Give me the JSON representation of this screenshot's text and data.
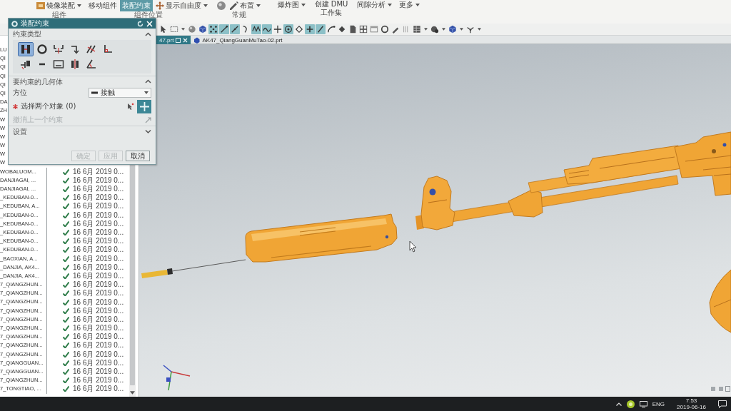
{
  "ribbon": {
    "groups": [
      {
        "label": "组件",
        "items": [
          {
            "label": "镜像装配",
            "selected": false,
            "dropdown": true
          }
        ]
      },
      {
        "label": "组件位置",
        "items": [
          {
            "label": "移动组件",
            "selected": false,
            "dropdown": false
          },
          {
            "label": "装配约束",
            "selected": true,
            "dropdown": false
          },
          {
            "label": "显示自由度",
            "selected": false,
            "dropdown": true
          }
        ]
      },
      {
        "label": "常规",
        "items": [
          {
            "label": "布置",
            "selected": false,
            "dropdown": true
          }
        ]
      },
      {
        "items": [
          {
            "label": "爆炸图",
            "selected": false,
            "dropdown": true
          },
          {
            "label": "创建 DMU 工作集",
            "selected": false,
            "dropdown": false
          },
          {
            "label": "间隙分析",
            "selected": false,
            "dropdown": true
          },
          {
            "label": "更多",
            "selected": false,
            "dropdown": true
          }
        ]
      }
    ]
  },
  "toolbar": [
    {
      "on": false
    },
    {
      "on": false
    },
    {
      "on": false
    },
    {
      "on": false
    },
    {
      "on": true
    },
    {
      "on": true
    },
    {
      "on": true
    },
    {
      "on": false
    },
    {
      "on": true
    },
    {
      "on": true
    },
    {
      "on": false
    },
    {
      "on": true
    },
    {
      "on": false
    },
    {
      "on": true
    },
    {
      "on": true
    },
    {
      "on": false
    },
    {
      "on": false
    },
    {
      "on": false
    },
    {
      "on": false
    },
    {
      "on": false
    },
    {
      "on": false
    },
    {
      "on": false
    },
    {
      "on": false
    },
    {
      "on": false
    },
    {
      "on": false
    },
    {
      "on": false
    },
    {
      "on": false
    }
  ],
  "dialog": {
    "title": "装配约束",
    "constraint_type": {
      "heading": "约束类型",
      "expanded": true,
      "types": [
        {
          "selected": true
        },
        {
          "selected": false
        },
        {
          "selected": false
        },
        {
          "selected": false
        },
        {
          "selected": false
        },
        {
          "selected": false
        },
        {
          "selected": false
        },
        {
          "selected": false
        },
        {
          "selected": false
        },
        {
          "selected": false
        },
        {
          "selected": false
        }
      ]
    },
    "geometry": {
      "heading": "要约束的几何体",
      "expanded": true,
      "orientation_label": "方位",
      "orientation_value": "接触",
      "select_label": "选择两个对象 (0)",
      "required": true,
      "select_active": true,
      "undo_label": "撤消上一个约束",
      "undo_disabled": true
    },
    "settings": {
      "heading": "设置",
      "expanded": false
    },
    "buttons": [
      {
        "label": "确定",
        "disabled": true
      },
      {
        "label": "应用",
        "disabled": true
      },
      {
        "label": "取消",
        "disabled": false
      }
    ]
  },
  "navigator": {
    "covered_rows": [
      {
        "name": "LU"
      },
      {
        "name": "QI"
      },
      {
        "name": "QI"
      },
      {
        "name": "QI"
      },
      {
        "name": "QI"
      },
      {
        "name": "QI"
      },
      {
        "name": "DA"
      },
      {
        "name": "ZH"
      },
      {
        "name": "W"
      },
      {
        "name": "W"
      },
      {
        "name": "W"
      },
      {
        "name": "W"
      },
      {
        "name": "W"
      },
      {
        "name": "W"
      }
    ],
    "rows": [
      {
        "name": "WOBALUOM...",
        "up_to_date": true,
        "modified": "16 6月 2019 0..."
      },
      {
        "name": "DANJIAGAI, ...",
        "up_to_date": true,
        "modified": "16 6月 2019 0..."
      },
      {
        "name": "DANJIAGAI, ...",
        "up_to_date": true,
        "modified": "16 6月 2019 0..."
      },
      {
        "name": "_KEDUBAN-0...",
        "up_to_date": true,
        "modified": "16 6月 2019 0..."
      },
      {
        "name": "_KEDUBAN, A...",
        "up_to_date": true,
        "modified": "16 6月 2019 0..."
      },
      {
        "name": "_KEDUBAN-0...",
        "up_to_date": true,
        "modified": "16 6月 2019 0..."
      },
      {
        "name": "_KEDUBAN-0...",
        "up_to_date": true,
        "modified": "16 6月 2019 0..."
      },
      {
        "name": "_KEDUBAN-0...",
        "up_to_date": true,
        "modified": "16 6月 2019 0..."
      },
      {
        "name": "_KEDUBAN-0...",
        "up_to_date": true,
        "modified": "16 6月 2019 0..."
      },
      {
        "name": "_KEDUBAN-0...",
        "up_to_date": true,
        "modified": "16 6月 2019 0..."
      },
      {
        "name": "_BAOXIAN, A...",
        "up_to_date": true,
        "modified": "16 6月 2019 0..."
      },
      {
        "name": "_DANJIA, AK4...",
        "up_to_date": true,
        "modified": "16 6月 2019 0..."
      },
      {
        "name": "_DANJIA, AK4...",
        "up_to_date": true,
        "modified": "16 6月 2019 0..."
      },
      {
        "name": "7_QIANGZHUN...",
        "up_to_date": true,
        "modified": "16 6月 2019 0..."
      },
      {
        "name": "7_QIANGZHUN...",
        "up_to_date": true,
        "modified": "16 6月 2019 0..."
      },
      {
        "name": "7_QIANGZHUN...",
        "up_to_date": true,
        "modified": "16 6月 2019 0..."
      },
      {
        "name": "7_QIANGZHUN...",
        "up_to_date": true,
        "modified": "16 6月 2019 0..."
      },
      {
        "name": "7_QIANGZHUN...",
        "up_to_date": true,
        "modified": "16 6月 2019 0..."
      },
      {
        "name": "7_QIANGZHUN...",
        "up_to_date": true,
        "modified": "16 6月 2019 0..."
      },
      {
        "name": "7_QIANGZHUN...",
        "up_to_date": true,
        "modified": "16 6月 2019 0..."
      },
      {
        "name": "7_QIANGZHUN...",
        "up_to_date": true,
        "modified": "16 6月 2019 0..."
      },
      {
        "name": "7_QIANGZHUN...",
        "up_to_date": true,
        "modified": "16 6月 2019 0..."
      },
      {
        "name": "7_QIANGGUAN...",
        "up_to_date": true,
        "modified": "16 6月 2019 0..."
      },
      {
        "name": "7_QIANGGUAN...",
        "up_to_date": true,
        "modified": "16 6月 2019 0..."
      },
      {
        "name": "7_QIANGZHUN...",
        "up_to_date": true,
        "modified": "16 6月 2019 0..."
      },
      {
        "name": "7_TONGTIAO, ...",
        "up_to_date": true,
        "modified": "16 6月 2019 0..."
      }
    ]
  },
  "tabs": [
    {
      "label": "47.prt",
      "selected": true
    },
    {
      "label": "AK47_QiangGuanMuTao-02.prt",
      "selected": false
    }
  ],
  "taskbar": {
    "language": "ENG",
    "time": "7:53",
    "date": "2019-06-16"
  }
}
